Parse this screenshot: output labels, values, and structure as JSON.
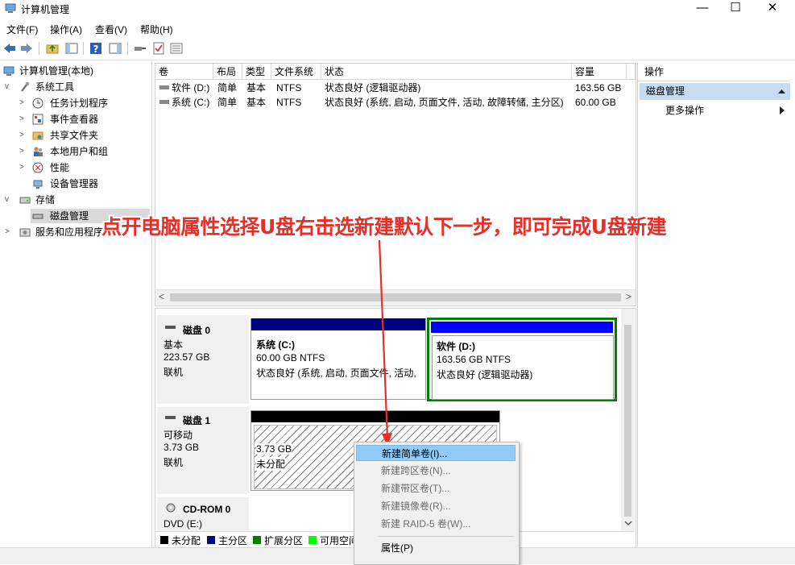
{
  "window": {
    "title": "计算机管理",
    "controls": {
      "minimize": "—",
      "maximize": "☐",
      "close": "✕"
    }
  },
  "menu": [
    "文件(F)",
    "操作(A)",
    "查看(V)",
    "帮助(H)"
  ],
  "tree": {
    "root": "计算机管理(本地)",
    "system_tools": "系统工具",
    "items": [
      "任务计划程序",
      "事件查看器",
      "共享文件夹",
      "本地用户和组",
      "性能",
      "设备管理器"
    ],
    "storage": "存储",
    "disk_management": "磁盘管理",
    "services": "服务和应用程序"
  },
  "volumes": {
    "headers": [
      "卷",
      "布局",
      "类型",
      "文件系统",
      "状态",
      "容量"
    ],
    "rows": [
      [
        "软件 (D:)",
        "简单",
        "基本",
        "NTFS",
        "状态良好 (逻辑驱动器)",
        "163.56 GB"
      ],
      [
        "系统 (C:)",
        "简单",
        "基本",
        "NTFS",
        "状态良好 (系统, 启动, 页面文件, 活动, 故障转储, 主分区)",
        "60.00 GB"
      ]
    ],
    "scroll_left": "<",
    "scroll_right": ">"
  },
  "disks": {
    "disk0": {
      "name": "磁盘 0",
      "type": "基本",
      "size": "223.57 GB",
      "status": "联机",
      "partitions": [
        {
          "title": "系统  (C:)",
          "line1": "60.00 GB NTFS",
          "line2": "状态良好 (系统, 启动, 页面文件, 活动,"
        },
        {
          "title": "软件  (D:)",
          "line1": "163.56 GB NTFS",
          "line2": "状态良好 (逻辑驱动器)"
        }
      ]
    },
    "disk1": {
      "name": "磁盘 1",
      "type": "可移动",
      "size": "3.73 GB",
      "status": "联机",
      "partition": {
        "line1": "3.73 GB",
        "line2": "未分配"
      }
    },
    "cdrom": {
      "name": "CD-ROM 0",
      "type": "DVD (E:)"
    }
  },
  "legend": [
    "未分配",
    "主分区",
    "扩展分区",
    "可用空间"
  ],
  "legend_colors": [
    "#000000",
    "#00007f",
    "#008000",
    "#00ff00"
  ],
  "actions": {
    "title": "操作",
    "section": "磁盘管理",
    "more": "更多操作"
  },
  "context_menu": {
    "items": [
      "新建简单卷(I)...",
      "新建跨区卷(N)...",
      "新建带区卷(T)...",
      "新建镜像卷(R)...",
      "新建 RAID-5 卷(W)..."
    ],
    "properties": "属性(P)"
  },
  "overlay": {
    "instruction": "点开电脑属性选择U盘右击选新建默认下一步，即可完成U盘新建"
  },
  "colors": {
    "primary_partition": "#00007f",
    "logical_drive": "#0000ff",
    "unallocated": "#000000",
    "selection_border": "#007f00",
    "highlight": "#91c9f7",
    "instruction_red": "#e5302a"
  }
}
